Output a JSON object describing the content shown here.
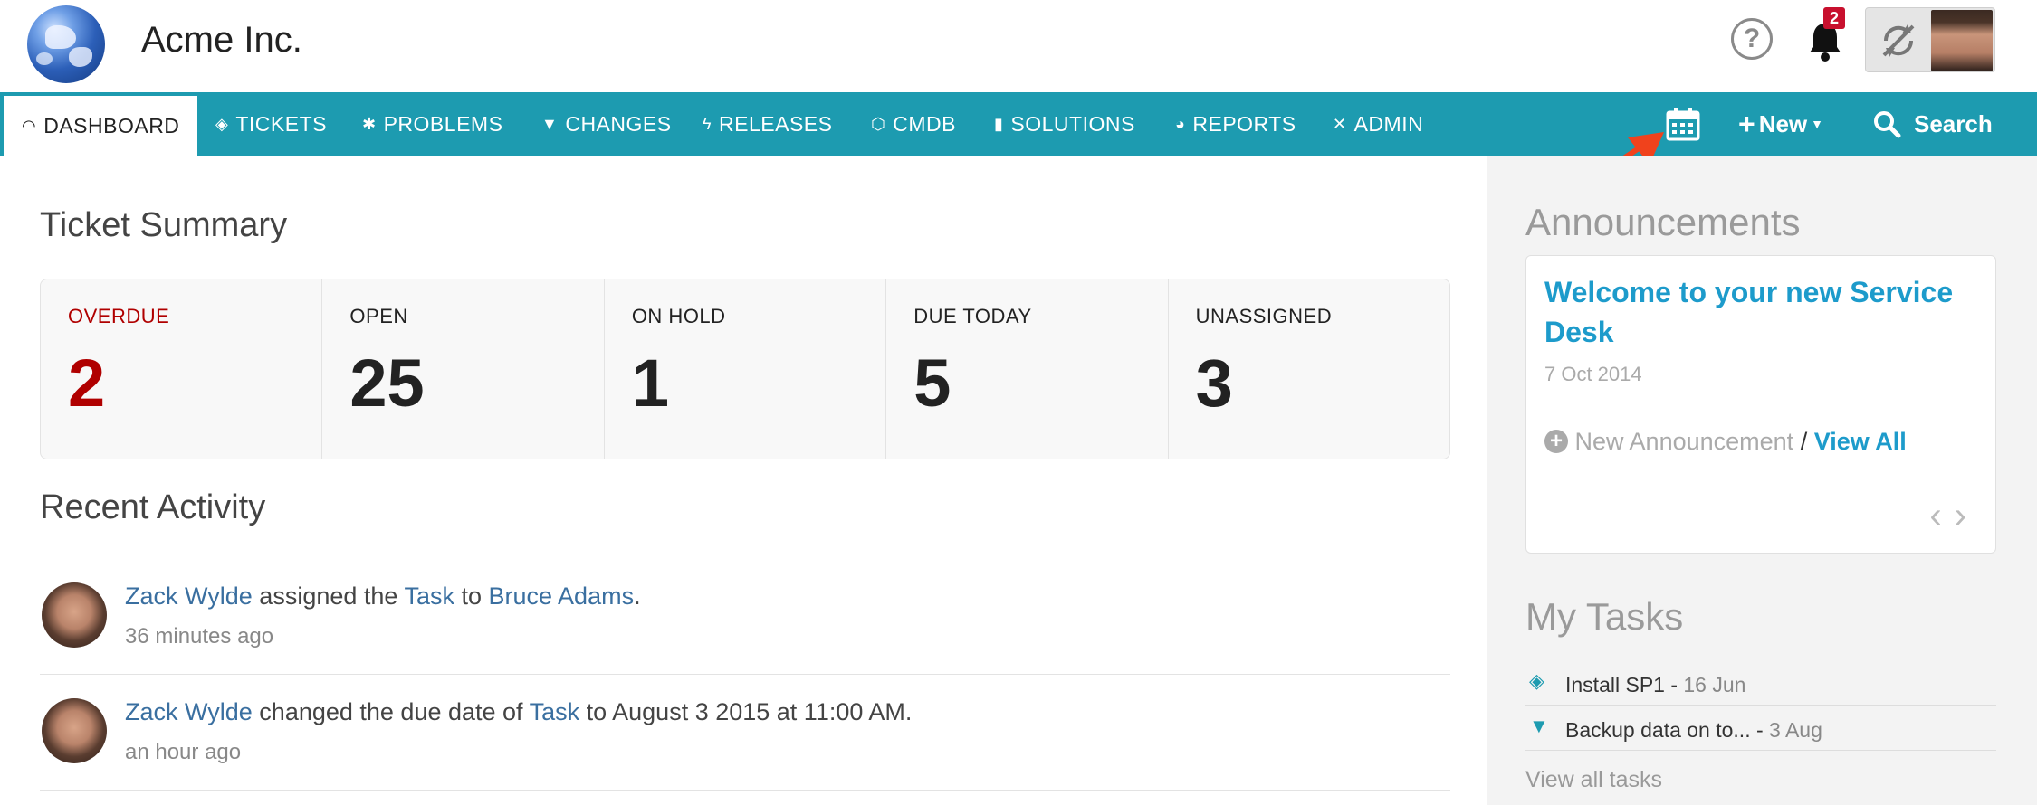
{
  "header": {
    "company": "Acme Inc.",
    "help_icon": "question-circle-icon",
    "notification_count": "2",
    "colors": {
      "accent": "#1d9bb0",
      "overdue": "#b00000",
      "link": "#1d9bcb"
    }
  },
  "nav": {
    "items": [
      {
        "label": "DASHBOARD",
        "icon": "gauge-icon"
      },
      {
        "label": "TICKETS",
        "icon": "ticket-icon"
      },
      {
        "label": "PROBLEMS",
        "icon": "bug-icon"
      },
      {
        "label": "CHANGES",
        "icon": "shield-icon"
      },
      {
        "label": "RELEASES",
        "icon": "bolt-icon"
      },
      {
        "label": "CMDB",
        "icon": "cube-icon"
      },
      {
        "label": "SOLUTIONS",
        "icon": "book-icon"
      },
      {
        "label": "REPORTS",
        "icon": "pie-icon"
      },
      {
        "label": "ADMIN",
        "icon": "tools-icon"
      }
    ],
    "new_label": "New",
    "search_label": "Search"
  },
  "summary": {
    "title": "Ticket Summary",
    "cells": [
      {
        "label": "OVERDUE",
        "value": "2"
      },
      {
        "label": "OPEN",
        "value": "25"
      },
      {
        "label": "ON HOLD",
        "value": "1"
      },
      {
        "label": "DUE TODAY",
        "value": "5"
      },
      {
        "label": "UNASSIGNED",
        "value": "3"
      }
    ]
  },
  "activity": {
    "title": "Recent Activity",
    "items": [
      {
        "user": "Zack Wylde",
        "verb": " assigned the ",
        "object": "Task",
        "mid": " to ",
        "target": "Bruce Adams",
        "tail": ".",
        "time": "36 minutes ago"
      },
      {
        "user": "Zack Wylde",
        "verb": " changed the due date of ",
        "object": "Task",
        "mid": " to August 3 2015 at 11:00 AM.",
        "target": "",
        "tail": "",
        "time": "an hour ago"
      }
    ]
  },
  "announcements": {
    "title": "Announcements",
    "heading": "Welcome to your new Service Desk",
    "date": "7 Oct 2014",
    "new_label": "New Announcement",
    "separator": " / ",
    "view_all": "View All"
  },
  "tasks": {
    "title": "My Tasks",
    "items": [
      {
        "label": "Install SP1 - ",
        "date": "16 Jun",
        "icon": "ticket-icon"
      },
      {
        "label": "Backup data on to... - ",
        "date": "3 Aug",
        "icon": "shield-icon"
      }
    ],
    "view_all": "View all tasks"
  }
}
